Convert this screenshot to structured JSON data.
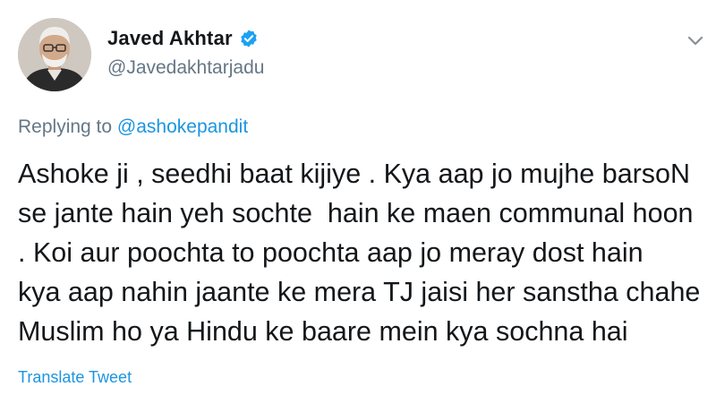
{
  "tweet": {
    "author": {
      "name": "Javed Akhtar",
      "handle": "@Javedakhtarjadu",
      "verified": true
    },
    "replying_prefix": "Replying to",
    "replying_to": "@ashokepandit",
    "text_lines": [
      "Ashoke ji , seedhi baat kijiye . Kya aap jo mujhe barsoN",
      "se jante hain yeh sochte  hain ke maen communal hoon",
      ". Koi aur poochta to poochta aap jo meray dost hain",
      "kya aap nahin jaante ke mera TJ jaisi her sanstha chahe",
      "Muslim ho ya Hindu ke baare mein kya sochna hai"
    ],
    "translate_label": "Translate Tweet"
  },
  "icons": {
    "verified": "verified-badge-icon",
    "caret": "chevron-down-icon"
  },
  "colors": {
    "link": "#1b95e0",
    "secondary_text": "#657786",
    "primary_text": "#14171a",
    "verified_badge": "#1da1f2"
  }
}
